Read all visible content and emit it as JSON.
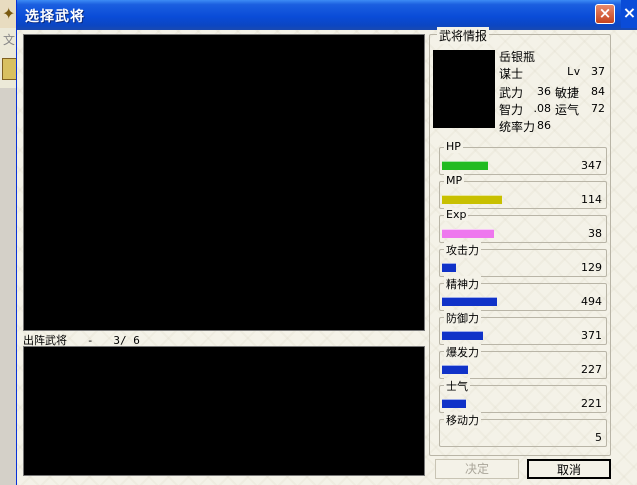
{
  "window": {
    "title": "选择武将",
    "close_glyph": "×"
  },
  "background": {
    "menu_text": "文"
  },
  "deploy": {
    "label": "出阵武将   -   3/ 6"
  },
  "info": {
    "title": "武将情报",
    "name": "岳银瓶",
    "class": "谋士",
    "level_label": "Lv",
    "level": "37",
    "stats": [
      {
        "label": "武力",
        "value": "36"
      },
      {
        "label": "敏捷",
        "value": "84"
      },
      {
        "label": "智力",
        "value": ".08"
      },
      {
        "label": "运气",
        "value": "72"
      }
    ],
    "command_label": "统率力",
    "command_value": "86"
  },
  "bars": [
    {
      "label": "HP",
      "value": "347",
      "fill": 0.36,
      "color": "#22bb22"
    },
    {
      "label": "MP",
      "value": "114",
      "fill": 0.47,
      "color": "#c8c000"
    },
    {
      "label": "Exp",
      "value": "38",
      "fill": 0.41,
      "color": "#ee77ee"
    },
    {
      "label": "攻击力",
      "value": "129",
      "fill": 0.11,
      "color": "#1032c8"
    },
    {
      "label": "精神力",
      "value": "494",
      "fill": 0.43,
      "color": "#1032c8"
    },
    {
      "label": "防御力",
      "value": "371",
      "fill": 0.32,
      "color": "#1032c8"
    },
    {
      "label": "爆发力",
      "value": "227",
      "fill": 0.2,
      "color": "#1032c8"
    },
    {
      "label": "士气",
      "value": "221",
      "fill": 0.19,
      "color": "#1032c8"
    },
    {
      "label": "移动力",
      "value": "5",
      "fill": 0,
      "color": "#1032c8"
    }
  ],
  "buttons": {
    "confirm": "决定",
    "cancel": "取消"
  }
}
